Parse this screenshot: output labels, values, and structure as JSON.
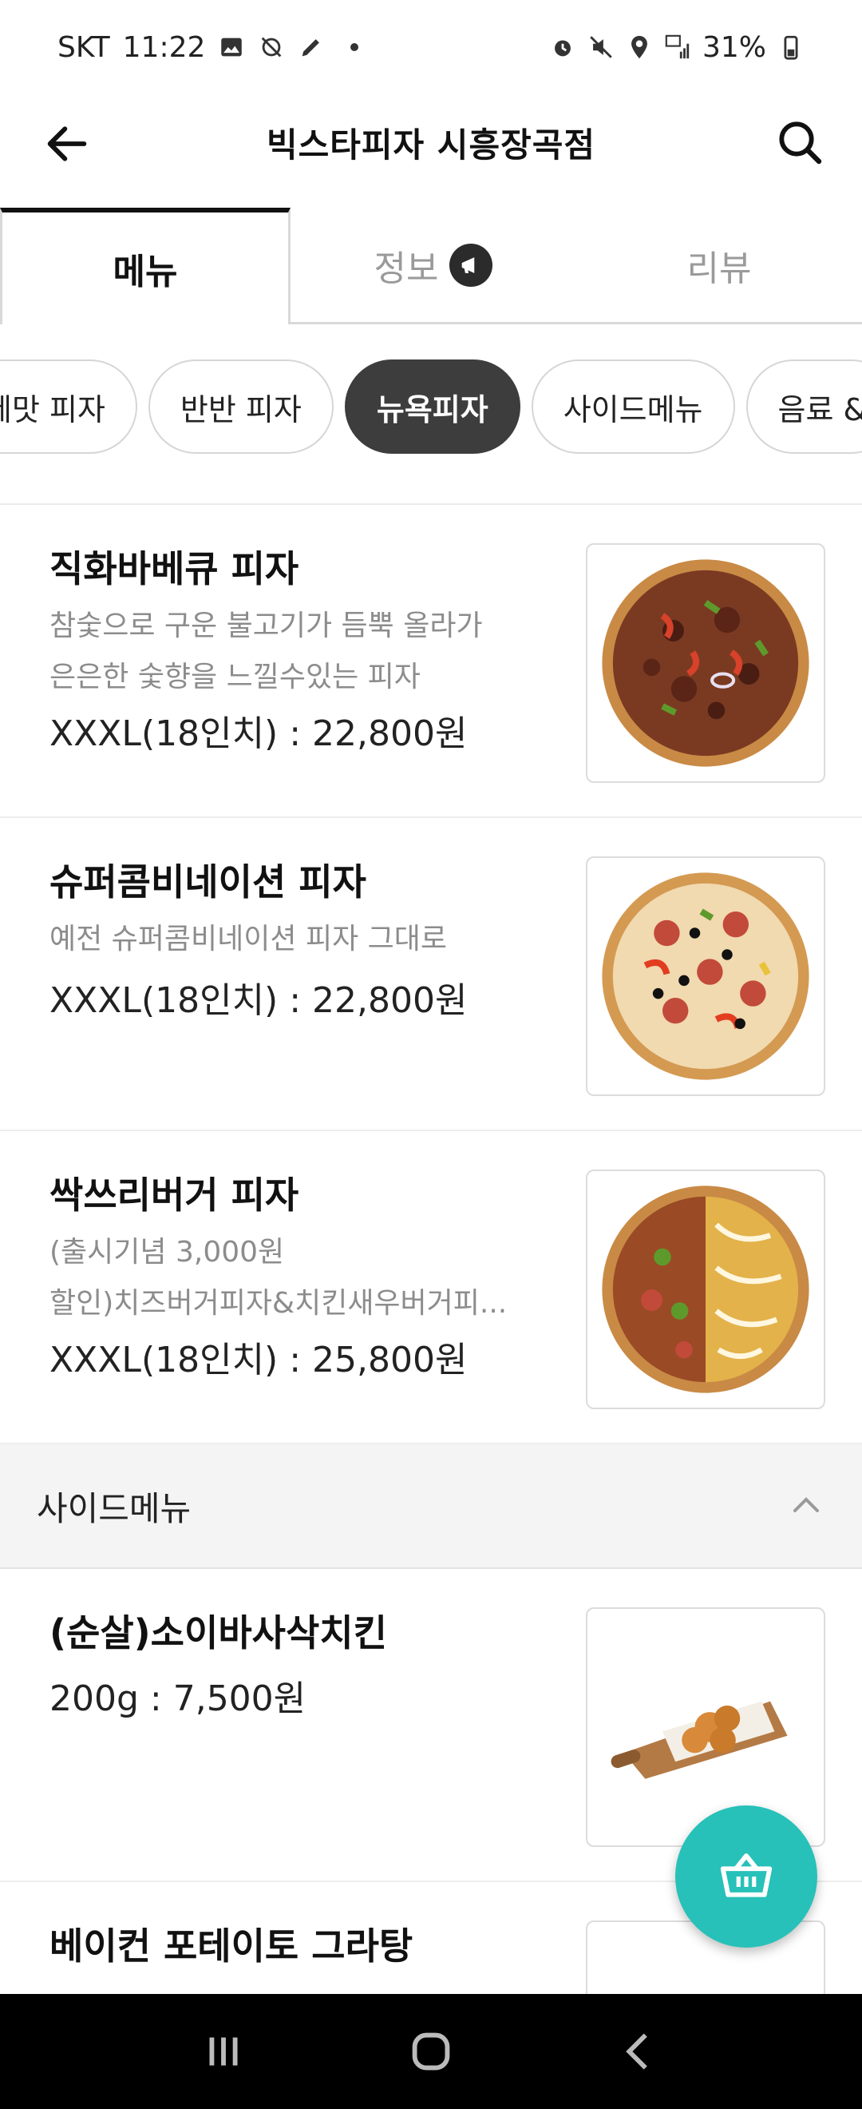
{
  "status": {
    "carrier": "SKT",
    "time": "11:22",
    "battery": "31%"
  },
  "header": {
    "title": "빅스타피자 시흥장곡점"
  },
  "tabs": [
    {
      "label": "메뉴"
    },
    {
      "label": "정보"
    },
    {
      "label": "리뷰"
    }
  ],
  "chips": [
    {
      "label": "제맛 피자"
    },
    {
      "label": "반반 피자"
    },
    {
      "label": "뉴욕피자"
    },
    {
      "label": "사이드메뉴"
    },
    {
      "label": "음료 &"
    }
  ],
  "items": [
    {
      "name": "직화바베큐 피자",
      "desc1": "참숯으로 구운 불고기가 듬뿍 올라가",
      "desc2": "은은한 숯향을 느낄수있는 피자",
      "price": "XXXL(18인치) : 22,800원"
    },
    {
      "name": "슈퍼콤비네이션 피자",
      "desc1": "예전 슈퍼콤비네이션 피자 그대로",
      "price": "XXXL(18인치) : 22,800원"
    },
    {
      "name": "싹쓰리버거 피자",
      "desc1": "(출시기념 3,000원",
      "desc2": "할인)치즈버거피자&치킨새우버거피...",
      "price": "XXXL(18인치) : 25,800원"
    }
  ],
  "section": {
    "label": "사이드메뉴"
  },
  "side_items": [
    {
      "name": "(순살)소이바사삭치킨",
      "price": "200g : 7,500원"
    },
    {
      "name": "베이컨 포테이토 그라탕"
    }
  ],
  "colors": {
    "accent": "#27c1b9",
    "chip_active": "#3d3d3d"
  }
}
